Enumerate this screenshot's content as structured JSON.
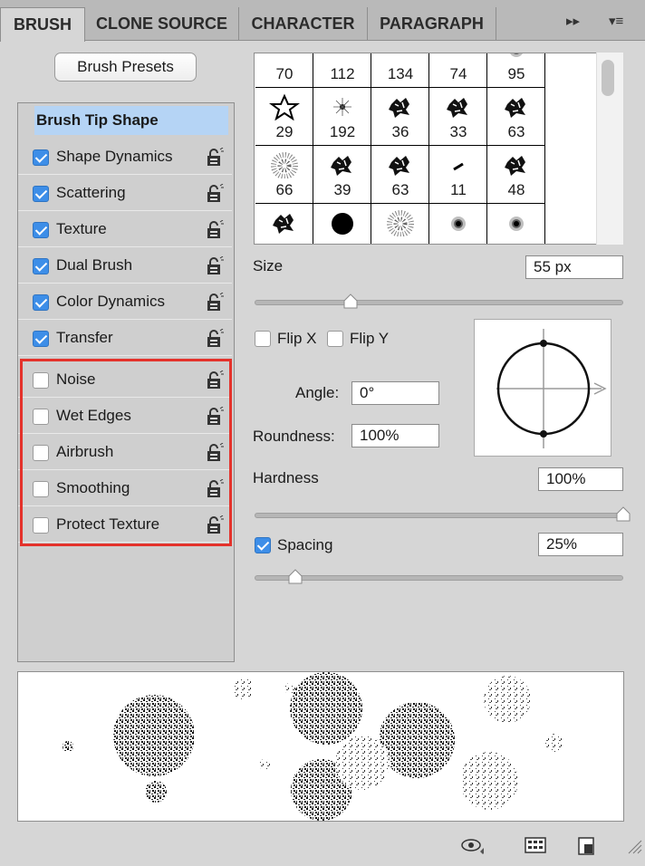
{
  "tabs": [
    {
      "label": "BRUSH",
      "active": true
    },
    {
      "label": "CLONE SOURCE",
      "active": false
    },
    {
      "label": "CHARACTER",
      "active": false
    },
    {
      "label": "PARAGRAPH",
      "active": false
    }
  ],
  "presets_button": "Brush Presets",
  "tip_shape_label": "Brush Tip Shape",
  "options": [
    {
      "label": "Shape Dynamics",
      "checked": true
    },
    {
      "label": "Scattering",
      "checked": true
    },
    {
      "label": "Texture",
      "checked": true
    },
    {
      "label": "Dual Brush",
      "checked": true
    },
    {
      "label": "Color Dynamics",
      "checked": true
    },
    {
      "label": "Transfer",
      "checked": true
    },
    {
      "label": "Noise",
      "checked": false
    },
    {
      "label": "Wet Edges",
      "checked": false
    },
    {
      "label": "Airbrush",
      "checked": false
    },
    {
      "label": "Smoothing",
      "checked": false
    },
    {
      "label": "Protect Texture",
      "checked": false
    }
  ],
  "brush_grid": [
    [
      "70",
      "112",
      "134",
      "74",
      "95"
    ],
    [
      "29",
      "192",
      "36",
      "33",
      "63"
    ],
    [
      "66",
      "39",
      "63",
      "11",
      "48"
    ],
    [
      "",
      "",
      "",
      "",
      ""
    ]
  ],
  "size": {
    "label": "Size",
    "value": "55 px",
    "level": 0.26
  },
  "flip_x": {
    "label": "Flip X",
    "checked": false
  },
  "flip_y": {
    "label": "Flip Y",
    "checked": false
  },
  "angle": {
    "label": "Angle:",
    "value": "0°"
  },
  "roundness": {
    "label": "Roundness:",
    "value": "100%"
  },
  "hardness": {
    "label": "Hardness",
    "value": "100%",
    "level": 1.0
  },
  "spacing": {
    "label": "Spacing",
    "value": "25%",
    "checked": true,
    "level": 0.11
  },
  "colors": {
    "accent": "#3d8ee8",
    "highlight": "#e4322b",
    "selection": "#b5d4f5"
  }
}
